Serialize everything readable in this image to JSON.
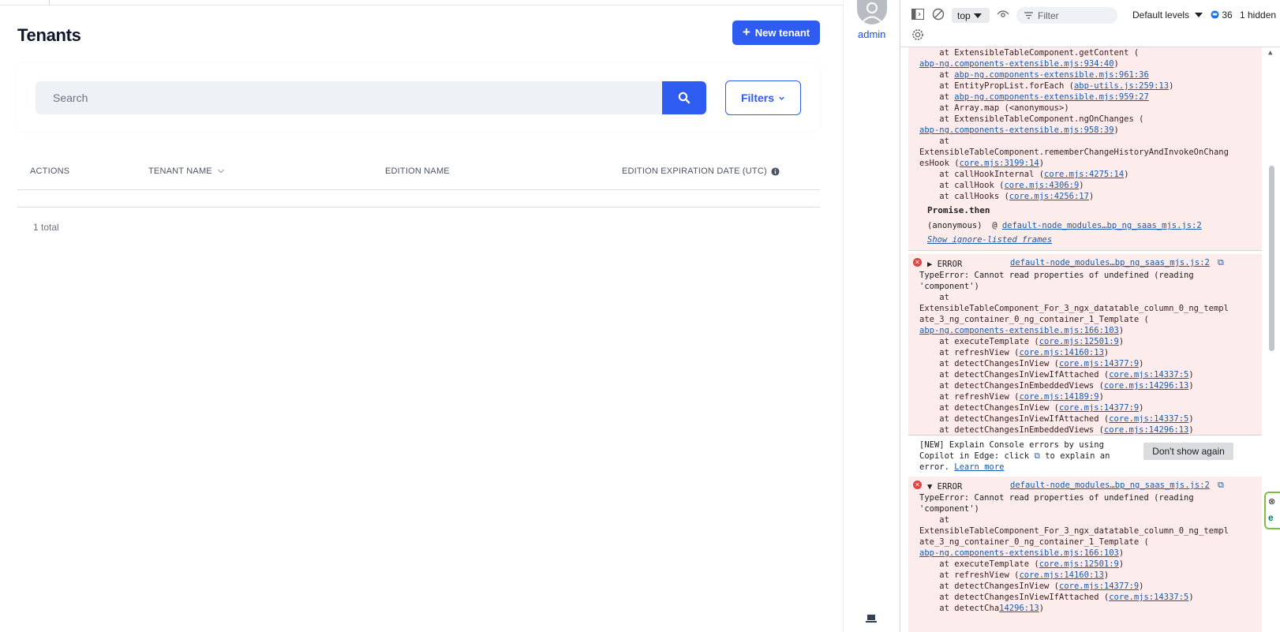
{
  "app": {
    "title": "Tenants",
    "new_button": "New tenant",
    "search_placeholder": "Search",
    "filters_button": "Filters",
    "columns": [
      "ACTIONS",
      "TENANT NAME",
      "EDITION NAME",
      "EDITION EXPIRATION DATE (UTC)"
    ],
    "total": "1 total",
    "user": "admin",
    "accent": "#2f5cf0"
  },
  "devtools": {
    "context": "top",
    "filter_placeholder": "Filter",
    "levels": "Default levels",
    "message_count": "36",
    "hidden": "1 hidden",
    "block1": [
      {
        "t": "    at ExtensibleTableComponent.getContent (",
        "l": ""
      },
      {
        "t": "",
        "l": "abp-ng.components-extensible.mjs:934:40",
        "s": ")"
      },
      {
        "t": "    at ",
        "l": "abp-ng.components-extensible.mjs:961:36"
      },
      {
        "t": "    at EntityPropList.forEach (",
        "l": "abp-utils.js:259:13",
        "s": ")"
      },
      {
        "t": "    at ",
        "l": "abp-ng.components-extensible.mjs:959:27"
      },
      {
        "t": "    at Array.map (<anonymous>)",
        "l": ""
      },
      {
        "t": "    at ExtensibleTableComponent.ngOnChanges (",
        "l": ""
      },
      {
        "t": "",
        "l": "abp-ng.components-extensible.mjs:958:39",
        "s": ")"
      },
      {
        "t": "    at",
        "l": ""
      },
      {
        "t": "ExtensibleTableComponent.rememberChangeHistoryAndInvokeOnChang",
        "l": ""
      },
      {
        "t": "esHook (",
        "l": "core.mjs:3199:14",
        "s": ")"
      },
      {
        "t": "    at callHookInternal (",
        "l": "core.mjs:4275:14",
        "s": ")"
      },
      {
        "t": "    at callHook (",
        "l": "core.mjs:4306:9",
        "s": ")"
      },
      {
        "t": "    at callHooks (",
        "l": "core.mjs:4256:17",
        "s": ")"
      }
    ],
    "promise_then": "Promise.then",
    "anonymous_label": "(anonymous)",
    "anonymous_link": "default-node_modules…bp_ng_saas_mjs.js:2",
    "show_frames": "Show ignore-listed frames",
    "error_label": "ERROR",
    "error_source": "default-node_modules…bp_ng_saas_mjs.js:2",
    "error_text_1": "TypeError: Cannot read properties of undefined (reading",
    "error_text_2": "'component')",
    "block2": [
      {
        "t": "    at",
        "l": ""
      },
      {
        "t": "ExtensibleTableComponent_For_3_ngx_datatable_column_0_ng_templ",
        "l": ""
      },
      {
        "t": "ate_3_ng_container_0_ng_container_1_Template (",
        "l": ""
      },
      {
        "t": "",
        "l": "abp-ng.components-extensible.mjs:166:103",
        "s": ")"
      },
      {
        "t": "    at executeTemplate (",
        "l": "core.mjs:12501:9",
        "s": ")"
      },
      {
        "t": "    at refreshView (",
        "l": "core.mjs:14160:13",
        "s": ")"
      },
      {
        "t": "    at detectChangesInView (",
        "l": "core.mjs:14377:9",
        "s": ")"
      },
      {
        "t": "    at detectChangesInViewIfAttached (",
        "l": "core.mjs:14337:5",
        "s": ")"
      },
      {
        "t": "    at detectChangesInEmbeddedViews (",
        "l": "core.mjs:14296:13",
        "s": ")"
      },
      {
        "t": "    at refreshView (",
        "l": "core.mjs:14189:9",
        "s": ")"
      },
      {
        "t": "    at detectChangesInView (",
        "l": "core.mjs:14377:9",
        "s": ")"
      },
      {
        "t": "    at detectChangesInViewIfAttached (",
        "l": "core.mjs:14337:5",
        "s": ")"
      },
      {
        "t": "    at detectChangesInEmbeddedViews (",
        "l": "core.mjs:14296:13",
        "s": ")"
      }
    ],
    "copilot_1": "[NEW] Explain Console errors by using",
    "copilot_2": "Copilot in Edge: click",
    "copilot_2b": "to explain an",
    "copilot_3": "error.",
    "learn_more": "Learn more",
    "dont_show": "Don't show again",
    "block3": [
      {
        "t": "    at",
        "l": ""
      },
      {
        "t": "ExtensibleTableComponent_For_3_ngx_datatable_column_0_ng_templ",
        "l": ""
      },
      {
        "t": "ate_3_ng_container_0_ng_container_1_Template (",
        "l": ""
      },
      {
        "t": "",
        "l": "abp-ng.components-extensible.mjs:166:103",
        "s": ")"
      },
      {
        "t": "    at executeTemplate (",
        "l": "core.mjs:12501:9",
        "s": ")"
      },
      {
        "t": "    at refreshView (",
        "l": "core.mjs:14160:13",
        "s": ")"
      },
      {
        "t": "    at detectChangesInView (",
        "l": "core.mjs:14377:9",
        "s": ")"
      },
      {
        "t": "    at detectChangesInViewIfAttached (",
        "l": "core.mjs:14337:5",
        "s": ")"
      },
      {
        "t": "    at detectCha",
        "l": "14296:13",
        "s": ")"
      }
    ]
  }
}
